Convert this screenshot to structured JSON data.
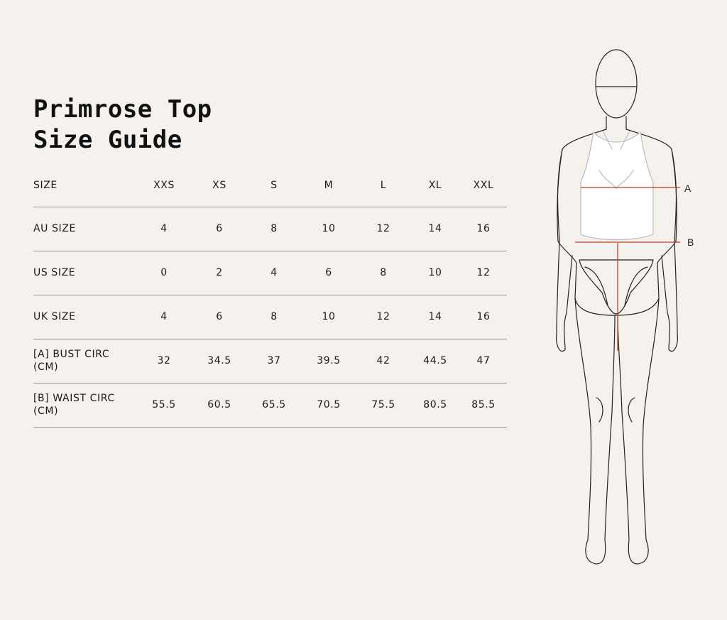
{
  "title": {
    "line1": "Primrose Top",
    "line2": "Size Guide"
  },
  "table": {
    "columns": [
      "SIZE",
      "XXS",
      "XS",
      "S",
      "M",
      "L",
      "XL",
      "XXL"
    ],
    "rows": [
      {
        "label": "AU SIZE",
        "values": [
          "4",
          "6",
          "8",
          "10",
          "12",
          "14",
          "16"
        ]
      },
      {
        "label": "US SIZE",
        "values": [
          "0",
          "2",
          "4",
          "6",
          "8",
          "10",
          "12"
        ]
      },
      {
        "label": "UK SIZE",
        "values": [
          "4",
          "6",
          "8",
          "10",
          "12",
          "14",
          "16"
        ]
      },
      {
        "label": "[A] BUST CIRC (CM)",
        "values": [
          "32",
          "34.5",
          "37",
          "39.5",
          "42",
          "44.5",
          "47"
        ]
      },
      {
        "label": "[B] WAIST CIRC (CM)",
        "values": [
          "55.5",
          "60.5",
          "65.5",
          "70.5",
          "75.5",
          "80.5",
          "85.5"
        ]
      }
    ]
  },
  "figure": {
    "markers": [
      {
        "label": "A"
      },
      {
        "label": "B"
      }
    ],
    "measure_line_color": "#c0392b"
  }
}
